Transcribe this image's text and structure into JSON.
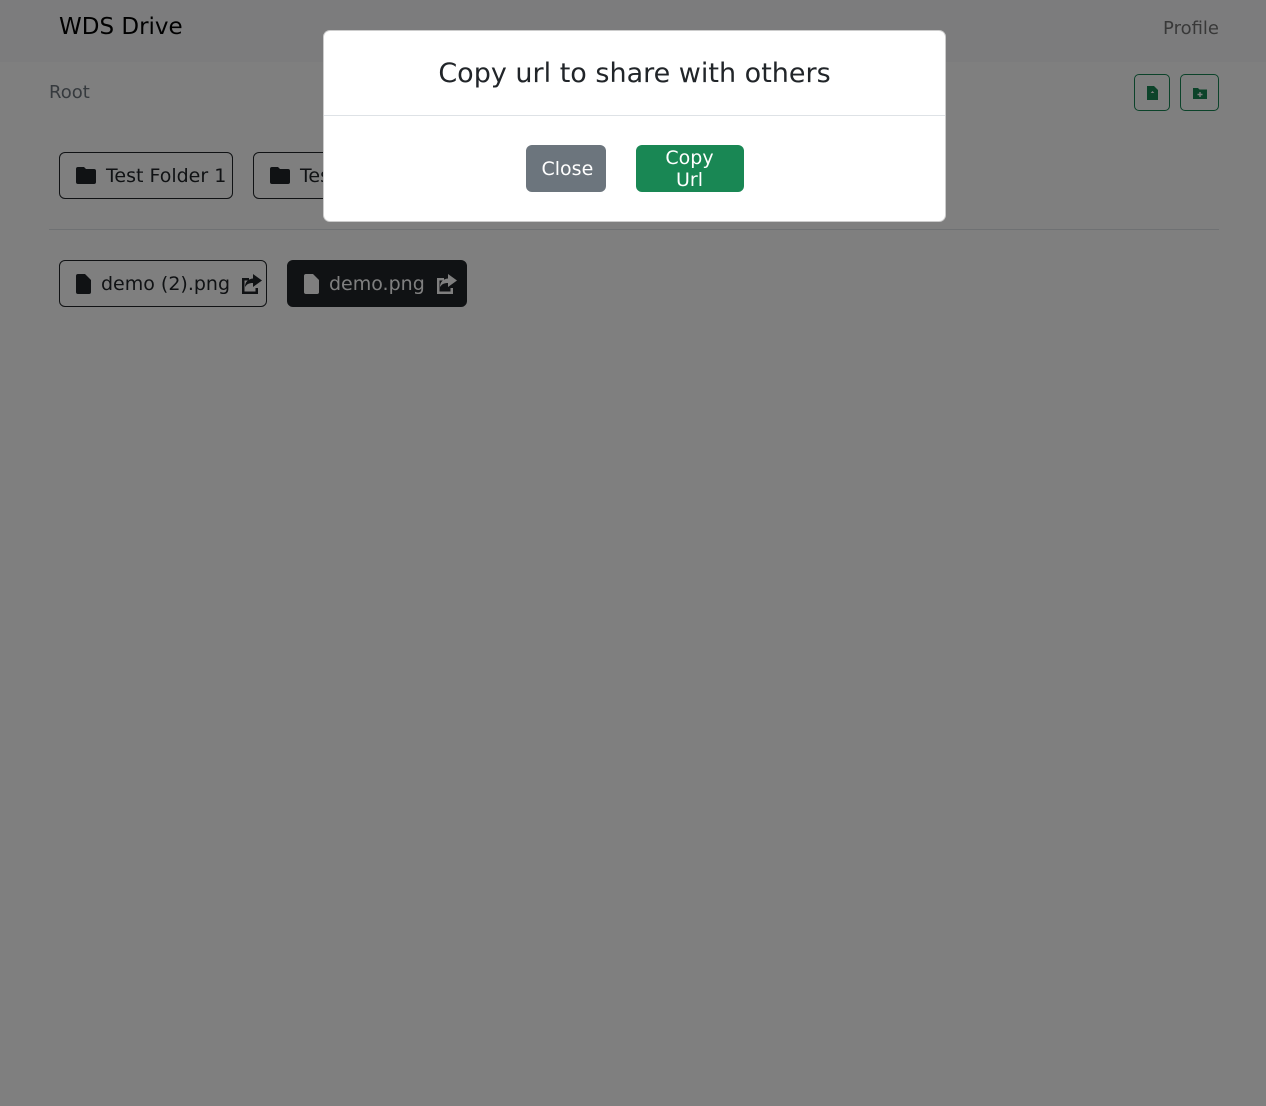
{
  "navbar": {
    "brand": "WDS Drive",
    "profile": "Profile"
  },
  "breadcrumb": {
    "root": "Root"
  },
  "actions": {
    "upload_icon": "file-upload-icon",
    "add_folder_icon": "folder-plus-icon"
  },
  "folders": [
    {
      "name": "Test Folder 1",
      "icon": "folder-icon"
    },
    {
      "name": "Tes",
      "icon": "folder-icon"
    }
  ],
  "files": [
    {
      "name": "demo (2).png",
      "icon": "file-icon",
      "share_icon": "share-icon"
    },
    {
      "name": "demo.png",
      "icon": "file-icon",
      "share_icon": "share-icon"
    }
  ],
  "modal": {
    "title": "Copy url to share with others",
    "close_label": "Close",
    "copy_label": "Copy Url"
  },
  "colors": {
    "accent": "#198754",
    "secondary": "#6c757d",
    "dark": "#212529",
    "backdrop": "rgba(0,0,0,0.5)"
  }
}
